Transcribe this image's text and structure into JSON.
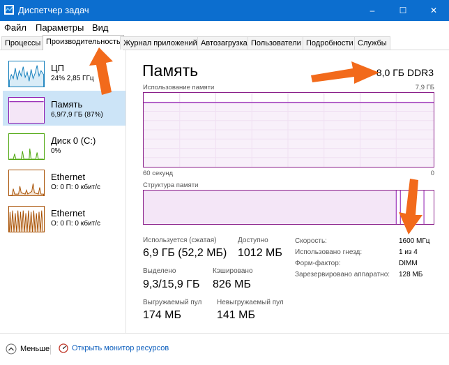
{
  "window": {
    "title": "Диспетчер задач",
    "controls": {
      "minimize": "–",
      "maximize": "☐",
      "close": "✕"
    }
  },
  "menu": [
    "Файл",
    "Параметры",
    "Вид"
  ],
  "tabs": [
    "Процессы",
    "Производительность",
    "Журнал приложений",
    "Автозагрузка",
    "Пользователи",
    "Подробности",
    "Службы"
  ],
  "active_tab": "Производительность",
  "sidebar": {
    "items": [
      {
        "name": "ЦП",
        "detail": "24%  2,85 ГГц",
        "color": "#117dbb"
      },
      {
        "name": "Память",
        "detail": "6,9/7,9 ГБ (87%)",
        "color": "#8b12ae"
      },
      {
        "name": "Диск 0 (C:)",
        "detail": "0%",
        "color": "#4da60c"
      },
      {
        "name": "Ethernet",
        "detail": "О: 0 П: 0 кбит/с",
        "color": "#a74f01"
      },
      {
        "name": "Ethernet",
        "detail": "О: 0 П: 0 кбит/с",
        "color": "#a74f01"
      }
    ],
    "selected_index": 1
  },
  "main": {
    "title": "Память",
    "spec": "8,0 ГБ DDR3",
    "usage_label": "Использование памяти",
    "usage_max": "7,9 ГБ",
    "time_left": "60 секунд",
    "time_right": "0",
    "usage_fraction": 0.87,
    "composition_label": "Структура памяти",
    "stats": {
      "in_use_label": "Используется (сжатая)",
      "in_use_value": "6,9 ГБ (52,2 МБ)",
      "available_label": "Доступно",
      "available_value": "1012 МБ",
      "committed_label": "Выделено",
      "committed_value": "9,3/15,9 ГБ",
      "cached_label": "Кэшировано",
      "cached_value": "826 МБ",
      "paged_label": "Выгружаемый пул",
      "paged_value": "174 МБ",
      "nonpaged_label": "Невыгружаемый пул",
      "nonpaged_value": "141 МБ"
    },
    "props": [
      {
        "label": "Скорость:",
        "value": "1600 МГц"
      },
      {
        "label": "Использовано гнезд:",
        "value": "1 из 4"
      },
      {
        "label": "Форм-фактор:",
        "value": "DIMM"
      },
      {
        "label": "Зарезервировано аппаратно:",
        "value": "128 МБ"
      }
    ]
  },
  "footer": {
    "less_label": "Меньше",
    "monitor_label": "Открыть монитор ресурсов"
  },
  "colors": {
    "titlebar": "#0c6ecf",
    "memory": "#8b12ae",
    "arrow": "#f26a1b"
  },
  "icons": [
    "task-manager-icon",
    "chevron-up-icon",
    "resource-monitor-icon"
  ]
}
